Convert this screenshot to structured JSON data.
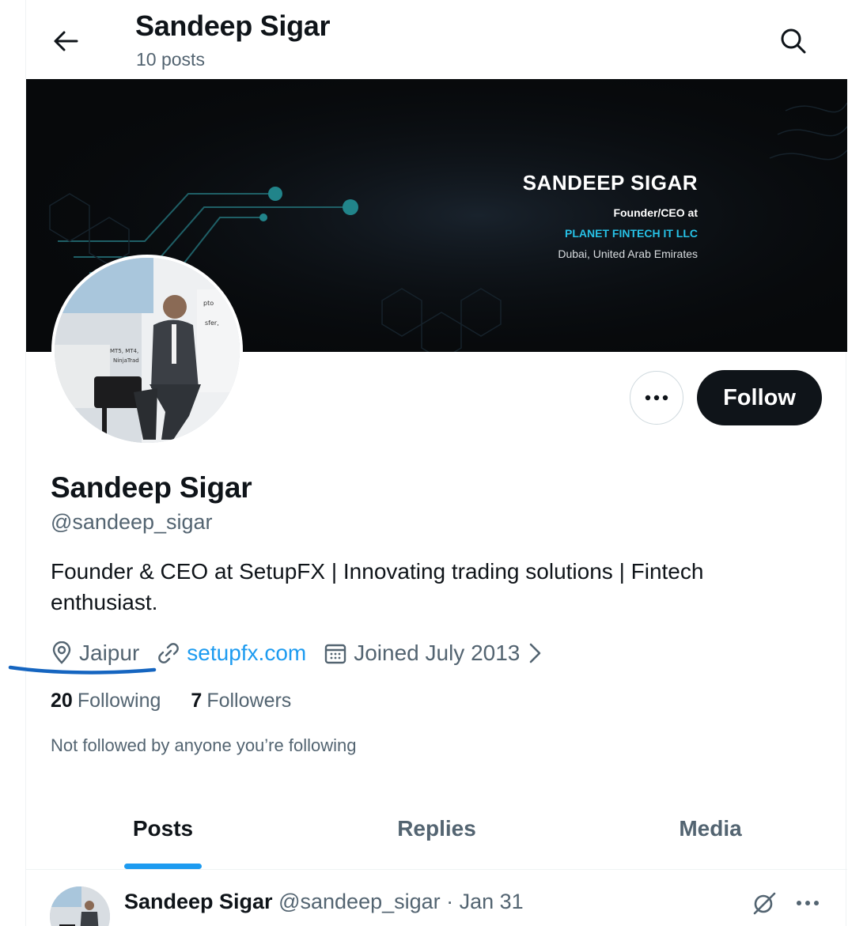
{
  "header": {
    "title": "Sandeep Sigar",
    "post_count": "10 posts",
    "back_icon": "arrow-left-icon",
    "search_icon": "search-icon"
  },
  "banner": {
    "name": "SANDEEP SIGAR",
    "role": "Founder/CEO at",
    "company": "PLANET FINTECH IT LLC",
    "location": "Dubai, United Arab Emirates",
    "colors": {
      "background": "#07090b",
      "accent": "#27c1e6"
    }
  },
  "actions": {
    "more_icon": "more-horizontal-icon",
    "follow_label": "Follow"
  },
  "profile": {
    "display_name": "Sandeep Sigar",
    "handle": "@sandeep_sigar",
    "bio": "Founder & CEO at SetupFX | Innovating trading solutions | Fintech enthusiast.",
    "location": "Jaipur",
    "website": "setupfx.com",
    "joined": "Joined July 2013",
    "following_count": "20",
    "following_label": "Following",
    "followers_count": "7",
    "followers_label": "Followers",
    "not_followed_text": "Not followed by anyone you’re following"
  },
  "tabs": [
    {
      "label": "Posts",
      "active": true
    },
    {
      "label": "Replies",
      "active": false
    },
    {
      "label": "Media",
      "active": false
    }
  ],
  "post": {
    "author_name": "Sandeep Sigar",
    "author_meta": "@sandeep_sigar · Jan 31"
  },
  "colors": {
    "link": "#1d9bf0",
    "text": "#0f1419",
    "secondary": "#536471",
    "annotation": "#1565c0"
  }
}
